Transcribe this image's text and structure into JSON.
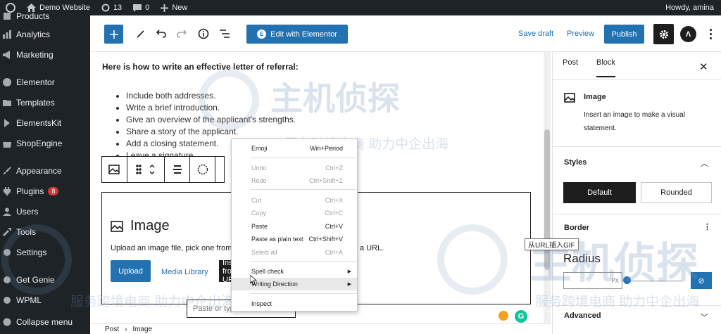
{
  "admin_bar": {
    "site_name": "Demo Website",
    "updates_count": "13",
    "comments_count": "0",
    "new_label": "New",
    "greeting": "Howdy, amina"
  },
  "sidebar": {
    "items": [
      {
        "label": "Products",
        "icon": "box-icon"
      },
      {
        "label": "Analytics",
        "icon": "chart-icon"
      },
      {
        "label": "Marketing",
        "icon": "megaphone-icon"
      },
      {
        "label": "Elementor",
        "icon": "elementor-icon"
      },
      {
        "label": "Templates",
        "icon": "folder-icon"
      },
      {
        "label": "ElementsKit",
        "icon": "elementskit-icon"
      },
      {
        "label": "ShopEngine",
        "icon": "shop-icon"
      },
      {
        "label": "Appearance",
        "icon": "brush-icon"
      },
      {
        "label": "Plugins",
        "icon": "plug-icon",
        "badge": "8"
      },
      {
        "label": "Users",
        "icon": "user-icon"
      },
      {
        "label": "Tools",
        "icon": "wrench-icon"
      },
      {
        "label": "Settings",
        "icon": "settings-icon"
      },
      {
        "label": "Get Genie",
        "icon": "genie-icon"
      },
      {
        "label": "WPML",
        "icon": "wpml-icon"
      },
      {
        "label": "Collapse menu",
        "icon": "collapse-icon"
      }
    ]
  },
  "header": {
    "elementor_label": "Edit with Elementor",
    "save_draft_label": "Save draft",
    "preview_label": "Preview",
    "publish_label": "Publish"
  },
  "content": {
    "heading": "Here is how to write an effective letter of referral:",
    "list": [
      "Include both addresses.",
      "Write a brief introduction.",
      "Give an overview of the applicant's strengths.",
      "Share a story of the applicant.",
      "Add a closing statement.",
      "Leave a signature."
    ]
  },
  "image_block": {
    "title": "Image",
    "description": "Upload an image file, pick one from",
    "description_tail": "a URL.",
    "upload_label": "Upload",
    "media_library_label": "Media Library",
    "insert_label": "Insert from URL",
    "url_placeholder": "Paste or type URL",
    "grammarly_label": "G"
  },
  "breadcrumb": {
    "items": [
      "Post",
      "Image"
    ]
  },
  "inspector": {
    "tabs": [
      "Post",
      "Block"
    ],
    "active_tab": "Block",
    "block_title": "Image",
    "block_description": "Insert an image to make a visual statement.",
    "styles_title": "Styles",
    "style_default": "Default",
    "style_rounded": "Rounded",
    "border_title": "Border",
    "radius_label": "Radius",
    "radius_unit": "PX",
    "advanced_title": "Advanced"
  },
  "context_menu": {
    "items": [
      {
        "label": "Emoji",
        "shortcut": "Win+Period",
        "disabled": false
      },
      {
        "label": "Undo",
        "shortcut": "Ctrl+Z",
        "disabled": true
      },
      {
        "label": "Redo",
        "shortcut": "Ctrl+Shift+Z",
        "disabled": true
      },
      {
        "label": "Cut",
        "shortcut": "Ctrl+X",
        "disabled": true
      },
      {
        "label": "Copy",
        "shortcut": "Ctrl+C",
        "disabled": true
      },
      {
        "label": "Paste",
        "shortcut": "Ctrl+V",
        "disabled": false
      },
      {
        "label": "Paste as plain text",
        "shortcut": "Ctrl+Shift+V",
        "disabled": false
      },
      {
        "label": "Select all",
        "shortcut": "Ctrl+A",
        "disabled": true
      },
      {
        "label": "Spell check",
        "shortcut": "",
        "disabled": false,
        "submenu": true
      },
      {
        "label": "Writing Direction",
        "shortcut": "",
        "disabled": false,
        "submenu": true
      },
      {
        "label": "Inspect",
        "shortcut": "",
        "disabled": false
      }
    ]
  },
  "tooltip": "从URL插入GIF",
  "watermark": {
    "brand": "主机侦探",
    "slogan": "服务跨境电商 助力中企出海"
  }
}
